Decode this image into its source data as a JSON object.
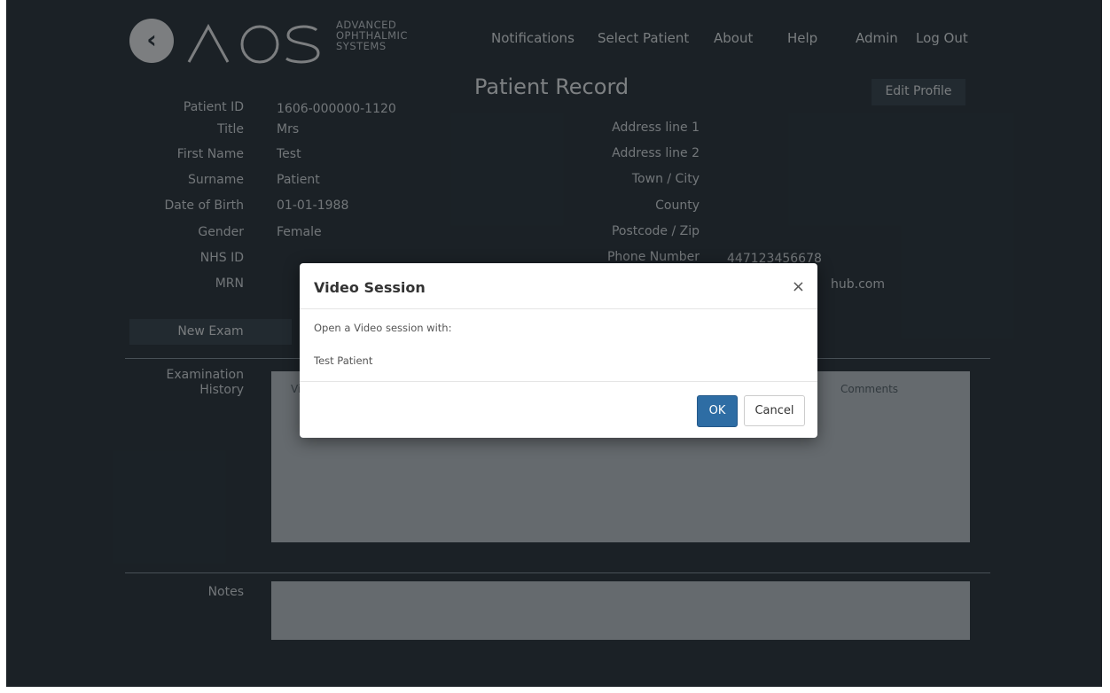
{
  "header": {
    "logo": {
      "brand": "AOS",
      "line1": "ADVANCED",
      "line2": "OPHTHALMIC",
      "line3": "SYSTEMS"
    },
    "nav": [
      "Notifications",
      "Select Patient",
      "About",
      "Help",
      "Admin",
      "Log Out"
    ]
  },
  "page": {
    "title": "Patient Record",
    "edit_profile": "Edit Profile",
    "new_exam": "New Exam"
  },
  "patient": {
    "labels": [
      "Patient ID",
      "Title",
      "First Name",
      "Surname",
      "Date of Birth",
      "Gender",
      "NHS ID",
      "MRN"
    ],
    "values": [
      "1606-000000-1120",
      "Mrs",
      "Test",
      "Patient",
      "01-01-1988",
      "Female",
      "",
      ""
    ]
  },
  "address": {
    "labels": [
      "Address line 1",
      "Address line 2",
      "Town / City",
      "County",
      "Postcode / Zip",
      "Phone Number"
    ],
    "phone": "447123456678",
    "email_visible": "hub.com"
  },
  "exam_history": {
    "label_line1": "Examination",
    "label_line2": "History",
    "col_first_partial": "Vi",
    "col_comments": "Comments"
  },
  "notes": {
    "label": "Notes"
  },
  "modal": {
    "title": "Video Session",
    "message": "Open a Video session with:",
    "patient_name": "Test Patient",
    "ok": "OK",
    "cancel": "Cancel",
    "close_glyph": "×"
  },
  "colors": {
    "background": "#2f3a43",
    "panel": "#aeb7bd",
    "primary_button": "#2e6da4"
  }
}
